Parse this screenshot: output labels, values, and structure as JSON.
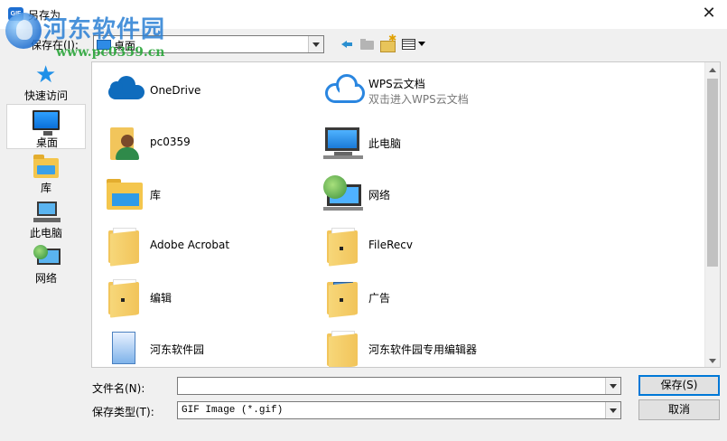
{
  "window": {
    "title": "另存为",
    "app_icon_text": "GIF",
    "close_glyph": "✕"
  },
  "watermark": {
    "title": "河东软件园",
    "url": "www.pc0359.cn"
  },
  "toolbar": {
    "save_in_label": "保存在(I):",
    "save_in_value": "桌面",
    "icons": [
      "back-icon",
      "up-folder-icon",
      "new-folder-icon",
      "view-menu-icon"
    ]
  },
  "places": [
    {
      "label": "快速访问",
      "icon": "star-icon"
    },
    {
      "label": "桌面",
      "icon": "desktop-icon",
      "selected": true
    },
    {
      "label": "库",
      "icon": "library-icon"
    },
    {
      "label": "此电脑",
      "icon": "computer-icon"
    },
    {
      "label": "网络",
      "icon": "network-icon"
    }
  ],
  "files": [
    {
      "name": "OneDrive",
      "icon": "onedrive-icon"
    },
    {
      "name": "WPS云文档",
      "sub": "双击进入WPS云文档",
      "icon": "wps-cloud-icon"
    },
    {
      "name": "pc0359",
      "icon": "user-folder-icon"
    },
    {
      "name": "此电脑",
      "icon": "computer-icon"
    },
    {
      "name": "库",
      "icon": "library-icon"
    },
    {
      "name": "网络",
      "icon": "network-icon"
    },
    {
      "name": "Adobe Acrobat",
      "icon": "folder-icon"
    },
    {
      "name": "FileRecv",
      "icon": "folder-icon"
    },
    {
      "name": "编辑",
      "icon": "folder-icon"
    },
    {
      "name": "广告",
      "icon": "folder-icon"
    },
    {
      "name": "河东软件园",
      "icon": "folder-icon"
    },
    {
      "name": "河东软件园专用编辑器",
      "icon": "folder-icon"
    }
  ],
  "form": {
    "filename_label": "文件名(N):",
    "filename_value": "",
    "filetype_label": "保存类型(T):",
    "filetype_value": "GIF Image (*.gif)"
  },
  "buttons": {
    "save": "保存(S)",
    "cancel": "取消"
  }
}
